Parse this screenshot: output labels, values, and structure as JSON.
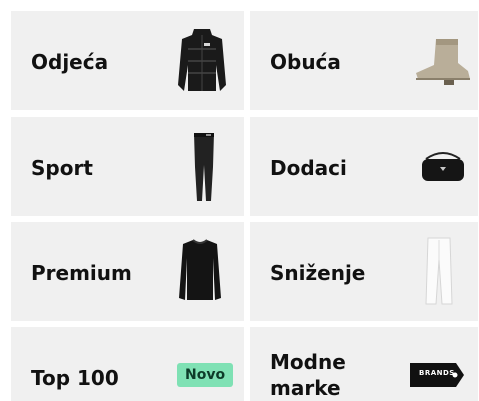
{
  "categories": [
    {
      "label": "Odjeća",
      "icon": "puffer-jacket-icon"
    },
    {
      "label": "Obuća",
      "icon": "ankle-boot-icon"
    },
    {
      "label": "Sport",
      "icon": "leggings-icon"
    },
    {
      "label": "Dodaci",
      "icon": "handbag-icon"
    },
    {
      "label": "Premium",
      "icon": "sweater-icon"
    },
    {
      "label": "Sniženje",
      "icon": "white-trousers-icon"
    },
    {
      "label": "Top 100",
      "badge": "Novo"
    },
    {
      "label": "Modne marke",
      "icon": "brands-tag-icon",
      "tag_text": "BRANDS"
    }
  ],
  "colors": {
    "tile_bg": "#f0f0f0",
    "badge_bg": "#7fe1b4",
    "text": "#111111"
  }
}
